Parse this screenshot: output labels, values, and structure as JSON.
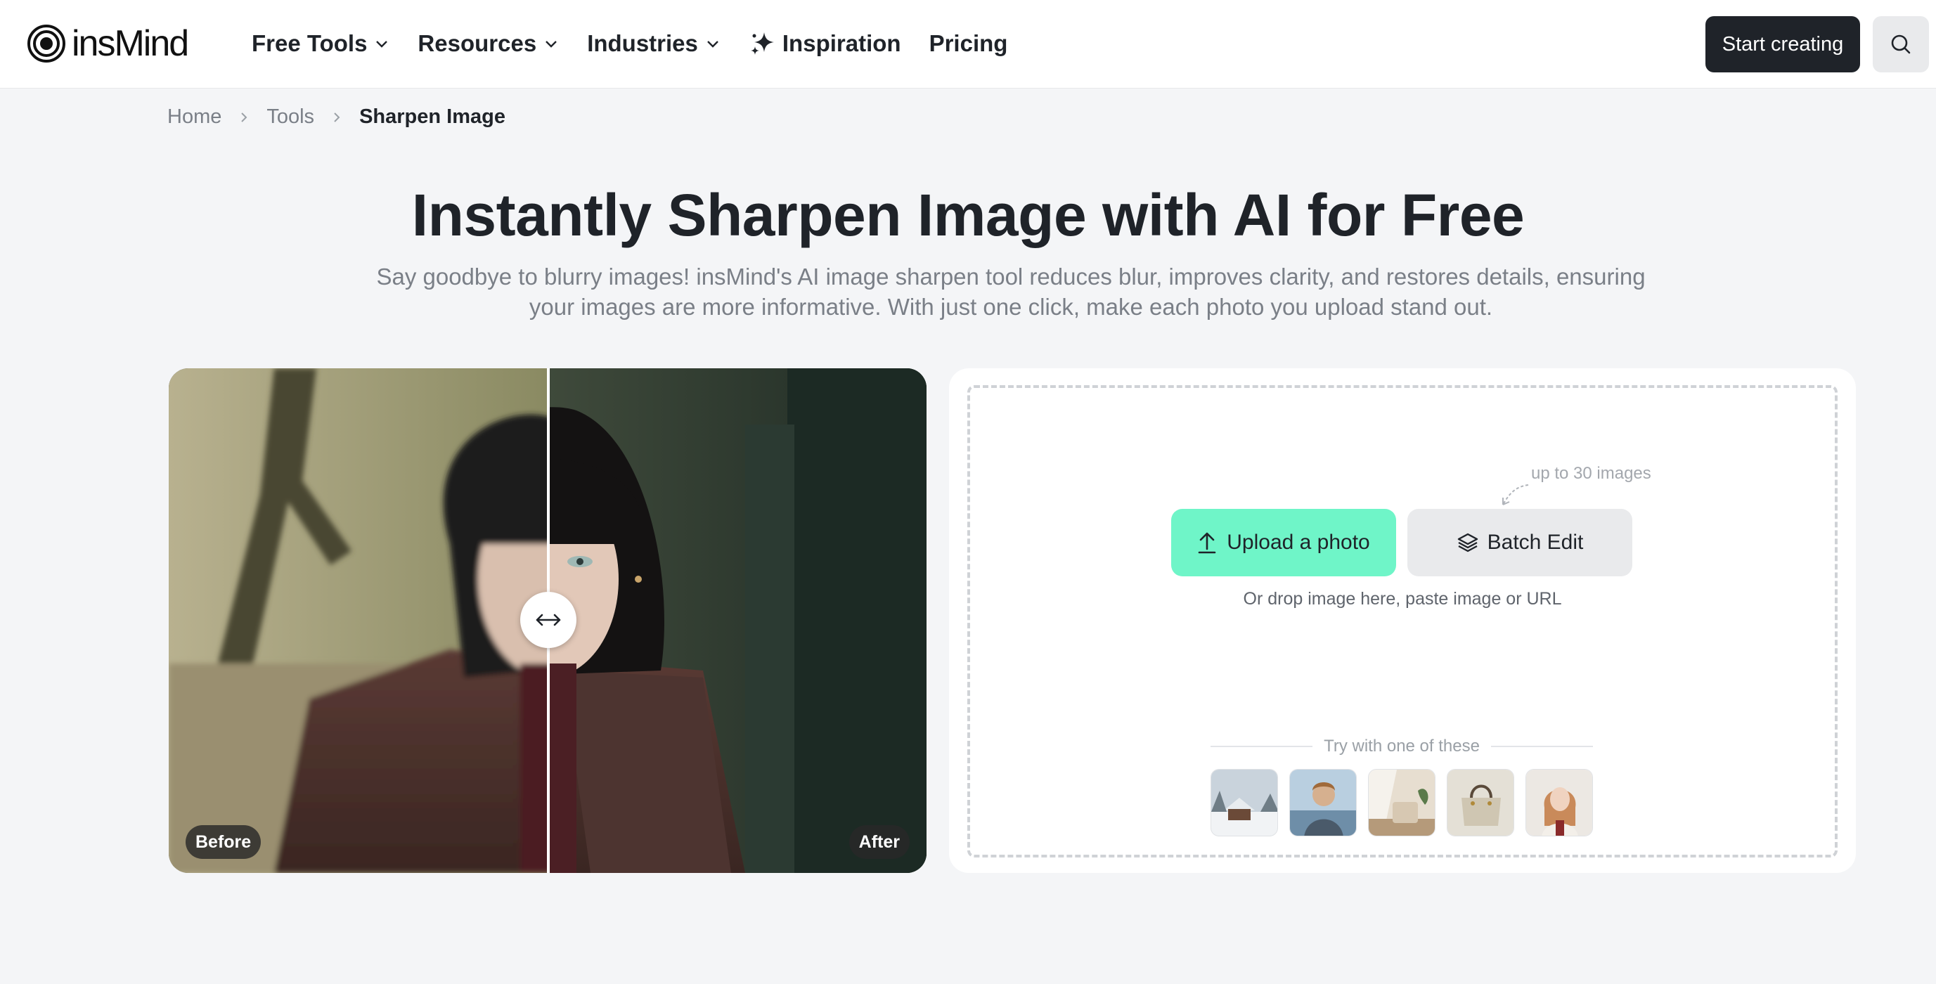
{
  "header": {
    "logo_text": "insMind",
    "nav": [
      {
        "label": "Free Tools",
        "has_dropdown": true
      },
      {
        "label": "Resources",
        "has_dropdown": true
      },
      {
        "label": "Industries",
        "has_dropdown": true
      },
      {
        "label": "Inspiration",
        "has_dropdown": false,
        "icon": "sparkle-icon"
      },
      {
        "label": "Pricing",
        "has_dropdown": false
      }
    ],
    "cta_label": "Start creating",
    "search_icon": "search-icon"
  },
  "breadcrumb": [
    "Home",
    "Tools",
    "Sharpen Image"
  ],
  "hero": {
    "title": "Instantly Sharpen Image with AI for Free",
    "subtitle": "Say goodbye to blurry images! insMind's AI image sharpen tool reduces blur, improves clarity, and restores details, ensuring your images are more informative. With just one click, make each photo you upload stand out."
  },
  "compare": {
    "before_label": "Before",
    "after_label": "After"
  },
  "upload": {
    "hint": "up to 30 images",
    "upload_label": "Upload a photo",
    "batch_label": "Batch Edit",
    "drop_text": "Or drop image here, paste image or URL",
    "try_label": "Try with one of these",
    "samples": [
      "snowy-cabin",
      "man-portrait",
      "interior-room",
      "handbag",
      "woman-portrait"
    ]
  },
  "colors": {
    "accent": "#6ff5c8",
    "dark": "#1f2329",
    "muted": "#7a7f87",
    "background": "#f4f5f7"
  }
}
